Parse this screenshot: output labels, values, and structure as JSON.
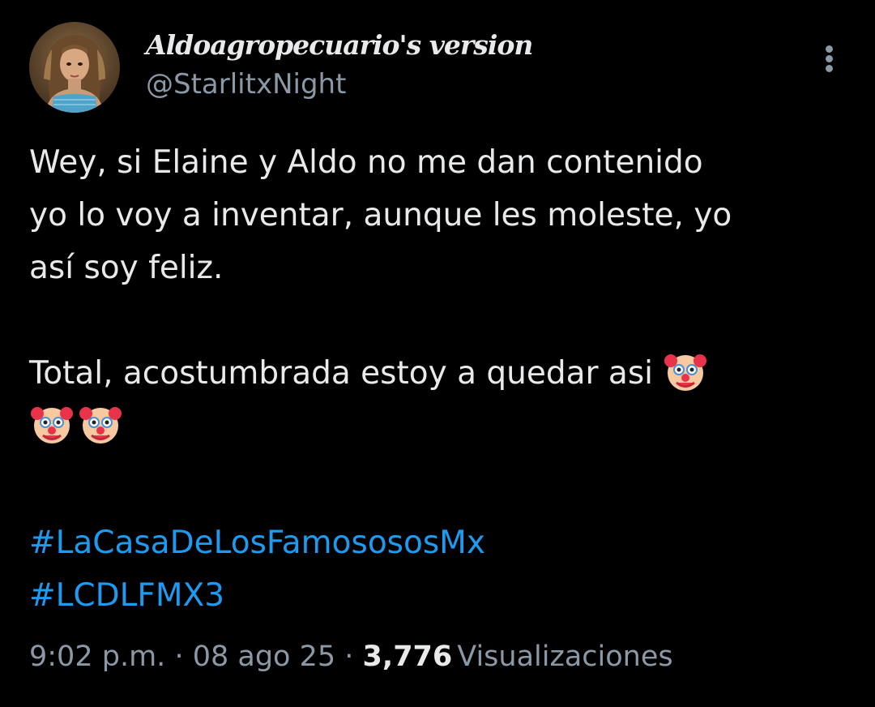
{
  "author": {
    "display_name": "Aldoagropecuario's version",
    "handle": "@StarlitxNight",
    "avatar_icon": "profile-photo"
  },
  "tweet": {
    "line1": "Wey, si Elaine y Aldo no me dan contenido",
    "line2": "yo lo voy a inventar, aunque les moleste, yo",
    "line3": "así soy feliz.",
    "line4": "Total, acostumbrada estoy a quedar asi",
    "emoji": "clown-face",
    "emoji_count": 3,
    "hashtags": [
      "#LaCasaDeLosFamosososMx",
      "#LCDLFMX3"
    ]
  },
  "meta": {
    "time": "9:02 p.m.",
    "separator": "·",
    "date": "08 ago 25",
    "views_count": "3,776",
    "views_label": "Visualizaciones"
  },
  "more_icon": "more-vertical-icon",
  "colors": {
    "background": "#000000",
    "text": "#e7e9ea",
    "secondary": "#8b98a5",
    "link": "#1d9bf0"
  }
}
